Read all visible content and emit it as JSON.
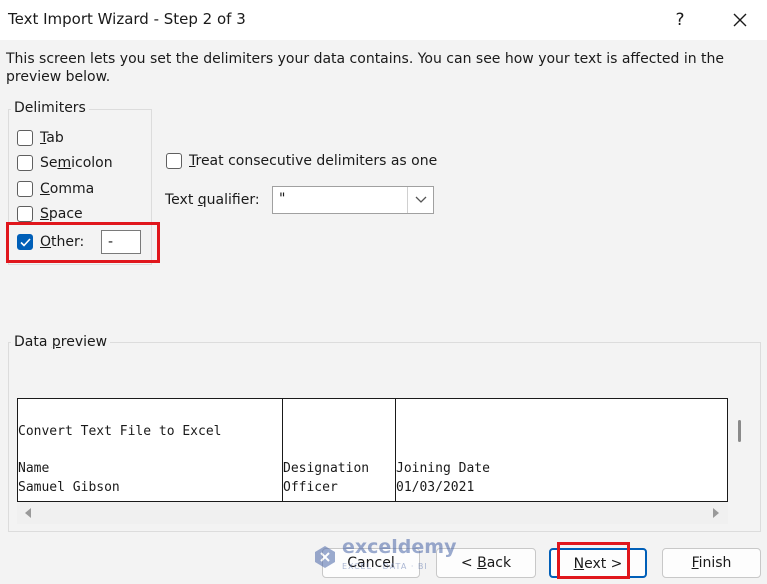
{
  "window": {
    "title": "Text Import Wizard - Step 2 of 3",
    "help_label": "?"
  },
  "description": "This screen lets you set the delimiters your data contains.  You can see how your text is affected in the preview below.",
  "delimiters": {
    "group_label": "Delimiters",
    "tab": {
      "label_pre": "",
      "label_u": "T",
      "label_post": "ab",
      "checked": false
    },
    "semicolon": {
      "label_pre": "Se",
      "label_u": "m",
      "label_post": "icolon",
      "checked": false
    },
    "comma": {
      "label_pre": "",
      "label_u": "C",
      "label_post": "omma",
      "checked": false
    },
    "space": {
      "label_pre": "",
      "label_u": "S",
      "label_post": "pace",
      "checked": false
    },
    "other": {
      "label_pre": "",
      "label_u": "O",
      "label_post": "ther:",
      "checked": true,
      "value": "-"
    }
  },
  "consecutive": {
    "label_pre": "",
    "label_u": "T",
    "label_post": "reat consecutive delimiters as one",
    "checked": false
  },
  "text_qualifier": {
    "label_pre": "Text ",
    "label_u": "q",
    "label_post": "ualifier:",
    "value": "\""
  },
  "preview": {
    "group_label_pre": "Data ",
    "group_label_u": "p",
    "group_label_post": "review",
    "line1": "Convert Text File to Excel",
    "headers": [
      "Name",
      "Designation",
      "Joining Date"
    ],
    "row1": [
      "Samuel Gibson",
      "Officer",
      "01/03/2021"
    ]
  },
  "buttons": {
    "cancel": "Cancel",
    "back_pre": "< ",
    "back_u": "B",
    "back_post": "ack",
    "next_u": "N",
    "next_post": "ext >",
    "finish_pre": "",
    "finish_u": "F",
    "finish_post": "inish"
  },
  "watermark": {
    "name": "exceldemy",
    "tagline": "EXCEL · DATA · BI"
  },
  "colors": {
    "accent": "#005fb8",
    "highlight": "#e0161c"
  }
}
